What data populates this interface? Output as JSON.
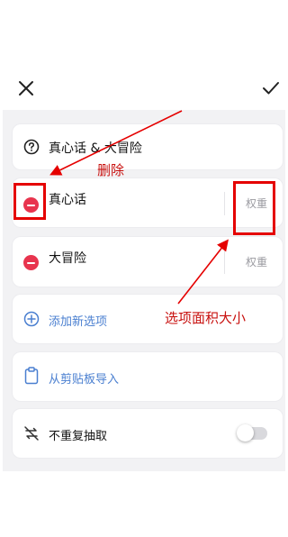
{
  "toolbar": {
    "close_icon": "close-icon",
    "confirm_icon": "check-icon"
  },
  "title_row": {
    "icon": "question-circle-icon",
    "title": "真心话 & 大冒险"
  },
  "options": [
    {
      "label": "真心话",
      "weight_placeholder": "权重"
    },
    {
      "label": "大冒险",
      "weight_placeholder": "权重"
    }
  ],
  "actions": {
    "add_option": "添加新选项",
    "import_clipboard": "从剪贴板导入"
  },
  "settings": {
    "no_repeat_label": "不重复抽取",
    "no_repeat_on": false
  },
  "annotations": {
    "delete_note": "删除",
    "weight_note": "选项面积大小",
    "color": "#e50000"
  }
}
